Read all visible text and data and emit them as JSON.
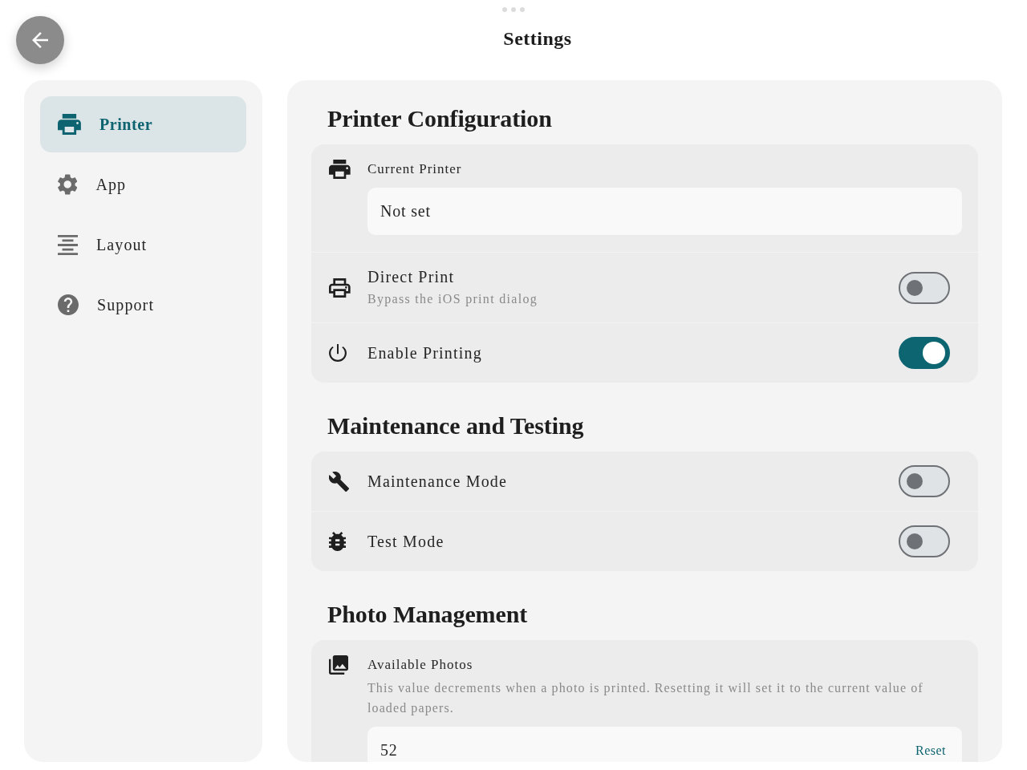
{
  "title": "Settings",
  "sidebar": {
    "items": [
      {
        "label": "Printer",
        "selected": true
      },
      {
        "label": "App",
        "selected": false
      },
      {
        "label": "Layout",
        "selected": false
      },
      {
        "label": "Support",
        "selected": false
      }
    ]
  },
  "sections": [
    {
      "heading": "Printer Configuration",
      "rows": [
        {
          "kind": "field",
          "label": "Current Printer",
          "value": "Not set"
        },
        {
          "kind": "toggle",
          "label": "Direct Print",
          "description": "Bypass the iOS print dialog",
          "on": false
        },
        {
          "kind": "toggle",
          "label": "Enable Printing",
          "on": true
        }
      ]
    },
    {
      "heading": "Maintenance and Testing",
      "rows": [
        {
          "kind": "toggle",
          "label": "Maintenance Mode",
          "on": false
        },
        {
          "kind": "toggle",
          "label": "Test Mode",
          "on": false
        }
      ]
    },
    {
      "heading": "Photo Management",
      "rows": [
        {
          "kind": "field",
          "label": "Available Photos",
          "description": "This value decrements when a photo is printed. Resetting it will set it to the current value of loaded papers.",
          "value": "52",
          "action": "Reset"
        }
      ]
    }
  ]
}
